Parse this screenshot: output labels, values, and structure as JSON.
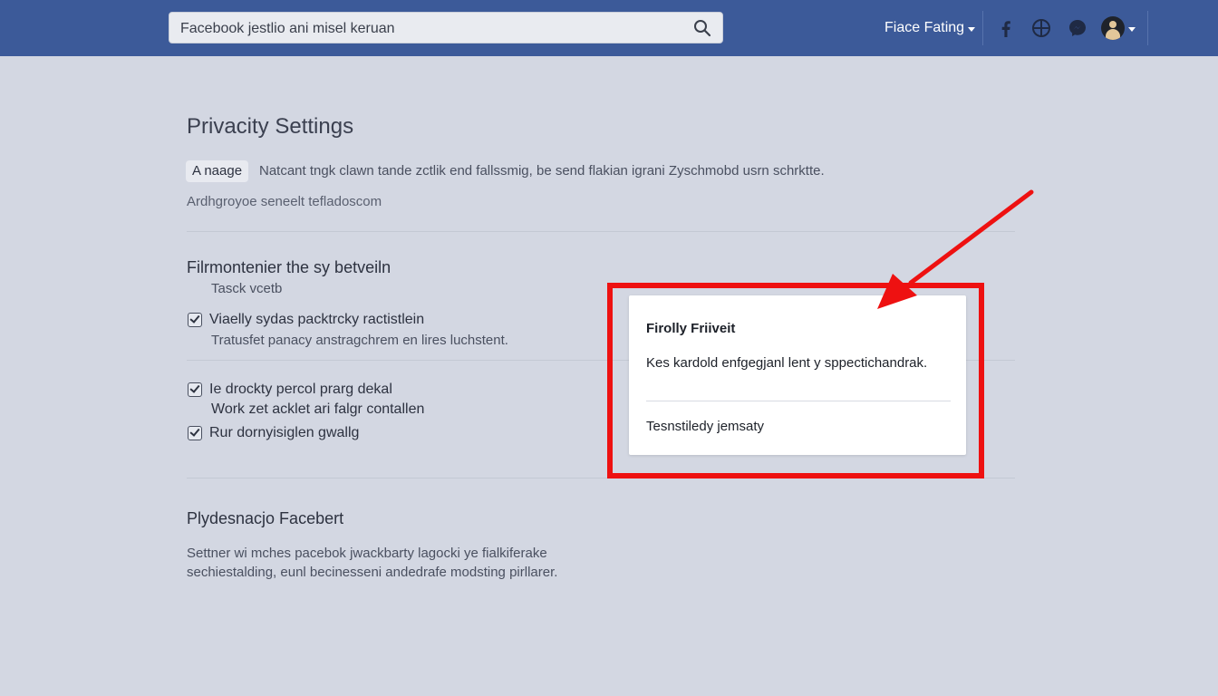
{
  "topbar": {
    "search_value": "Facebook jestlio ani misel keruan",
    "account_name": "Fiace Fating"
  },
  "icons": [
    "search-icon",
    "facebook-icon",
    "globe-icon",
    "messenger-icon",
    "avatar",
    "chevron-down-icon"
  ],
  "colors": {
    "topbar": "#3c5a99",
    "background": "#d3d7e2",
    "highlight": "#ee1111"
  },
  "main": {
    "title": "Privacity Settings",
    "manage_label": "A naage",
    "intro": "Natcant tngk clawn tande zctlik end fallssmig, be send flakian igrani Zyschmobd usrn schrktte.",
    "subline": "Ardhgroyoe seneelt tefladoscom",
    "section1": {
      "title": "Filrmontenier the sy betveiln",
      "subtitle": "Tasck vcetb",
      "check1_label": "Viaelly sydas packtrcky ractistlein",
      "check1_desc": "Tratusfet panacy anstragchrem en lires luchstent."
    },
    "section2": {
      "check2_label": "Ie drockty percol prarg dekal",
      "check2_desc": "Work zet acklet ari falgr contallen",
      "check3_label": "Rur dornyisiglen gwallg"
    },
    "section3": {
      "title": "Plydesnacjo Facebert",
      "desc_line1": "Settner wi mches pacebok jwackbarty lagocki ye fialkiferake",
      "desc_line2": "sechiestalding, eunl becinesseni andedrafe modsting pirllarer."
    }
  },
  "popup": {
    "title": "Firolly Friiveit",
    "body": "Kes kardold  enfgegjanl lent y sppectichandrak.",
    "link": "Tesnstiledy jemsaty"
  }
}
